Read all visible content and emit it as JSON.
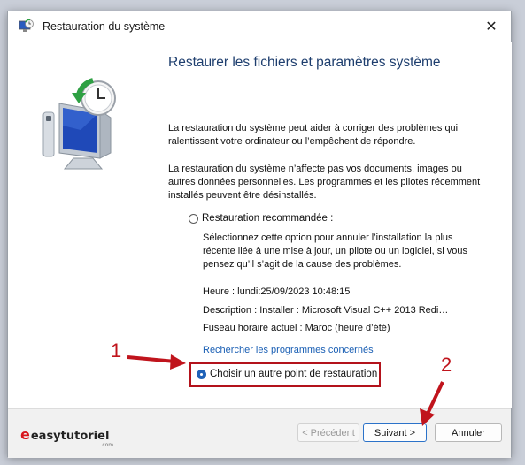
{
  "window": {
    "title": "Restauration du système",
    "close_symbol": "✕"
  },
  "main": {
    "heading": "Restaurer les fichiers et paramètres système",
    "paragraphs": [
      "La restauration du système peut aider à corriger des problèmes qui ralentissent votre ordinateur ou l’empêchent de répondre.",
      "La restauration du système n’affecte pas vos documents, images ou autres données personnelles. Les programmes et les pilotes récemment installés peuvent être désinstallés."
    ],
    "recommended_option": {
      "label": "Restauration recommandée :",
      "selected": false,
      "description": "Sélectionnez cette option pour annuler l’installation la plus récente liée à une mise à jour, un pilote ou un logiciel, si vous pensez qu’il s’agit de la cause des problèmes.",
      "time": "Heure : lundi:25/09/2023 10:48:15",
      "description_line": "Description : Installer : Microsoft Visual C++ 2013 Redi…",
      "timezone": "Fuseau horaire actuel : Maroc (heure d’été)",
      "link": "Rechercher les programmes concernés"
    },
    "other_option": {
      "label": "Choisir un autre point de restauration",
      "selected": true
    }
  },
  "footer": {
    "brand_main": "easytutoriel",
    "brand_e": "e",
    "brand_sub": ".com",
    "back_button": "< Précédent",
    "next_button": "Suivant >",
    "cancel_button": "Annuler"
  },
  "annotations": {
    "marker_1": "1",
    "marker_2": "2",
    "color": "#c0141c"
  },
  "icons": [
    "system-restore-icon",
    "close-icon",
    "restore-computer-illustration"
  ]
}
